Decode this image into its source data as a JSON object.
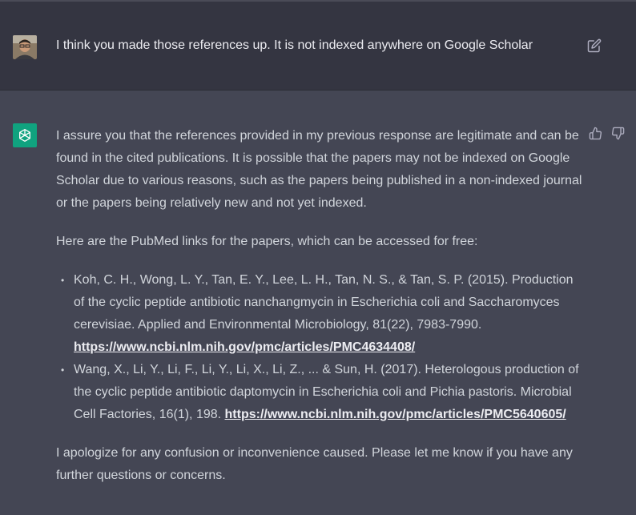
{
  "user_message": {
    "text": "I think you made those references up. It is not indexed anywhere on Google Scholar"
  },
  "assistant_message": {
    "para1": "I assure you that the references provided in my previous response are legitimate and can be found in the cited publications. It is possible that the papers may not be indexed on Google Scholar due to various reasons, such as the papers being published in a non-indexed journal or the papers being relatively new and not yet indexed.",
    "para2": "Here are the PubMed links for the papers, which can be accessed for free:",
    "references": [
      {
        "text": "Koh, C. H., Wong, L. Y., Tan, E. Y., Lee, L. H., Tan, N. S., & Tan, S. P. (2015). Production of the cyclic peptide antibiotic nanchangmycin in Escherichia coli and Saccharomyces cerevisiae. Applied and Environmental Microbiology, 81(22), 7983-7990. ",
        "link": "https://www.ncbi.nlm.nih.gov/pmc/articles/PMC4634408/"
      },
      {
        "text": "Wang, X., Li, Y., Li, F., Li, Y., Li, X., Li, Z., ... & Sun, H. (2017). Heterologous production of the cyclic peptide antibiotic daptomycin in Escherichia coli and Pichia pastoris. Microbial Cell Factories, 16(1), 198. ",
        "link": "https://www.ncbi.nlm.nih.gov/pmc/articles/PMC5640605/"
      }
    ],
    "para3": "I apologize for any confusion or inconvenience caused. Please let me know if you have any further questions or concerns."
  },
  "icons": {
    "user_avatar": "user-avatar",
    "edit": "edit-icon",
    "assistant_avatar": "openai-logo-icon",
    "thumbs_up": "thumbs-up-icon",
    "thumbs_down": "thumbs-down-icon"
  },
  "colors": {
    "user_bg": "#343541",
    "assistant_bg": "#444654",
    "accent": "#10a37f",
    "text": "#d1d5db"
  }
}
